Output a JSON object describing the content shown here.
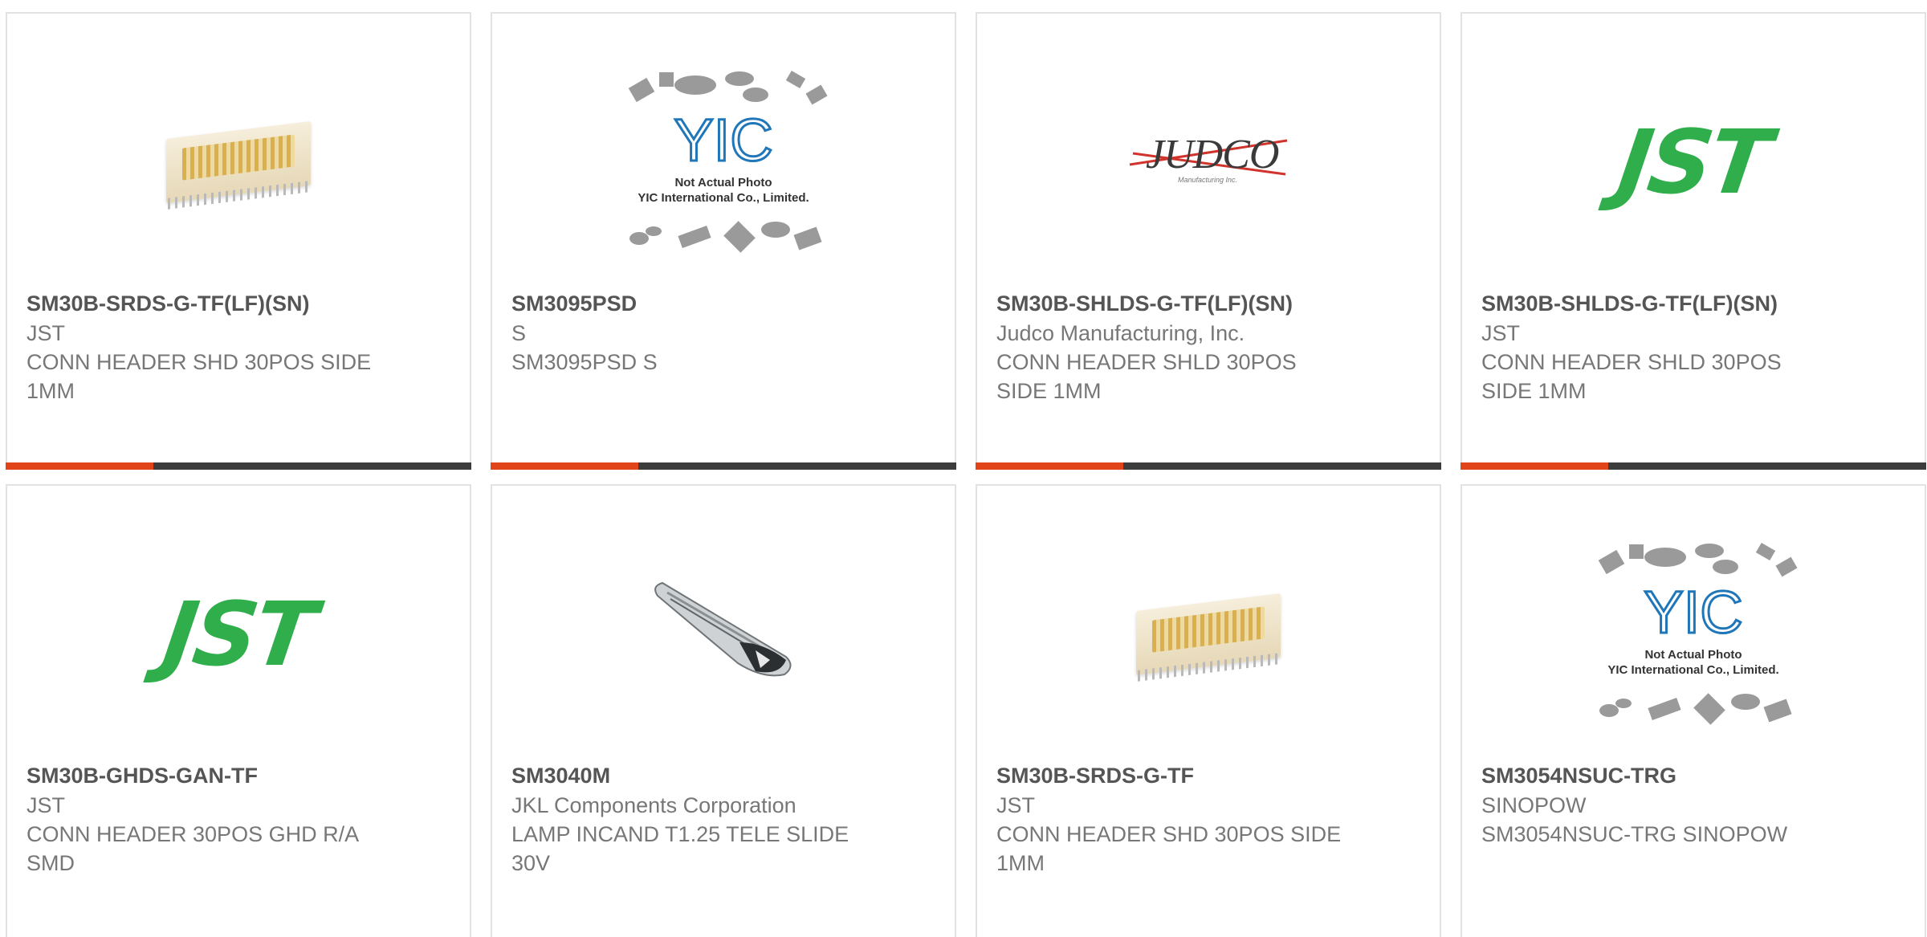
{
  "products": [
    {
      "part_number": "SM30B-SRDS-G-TF(LF)(SN)",
      "manufacturer": "JST",
      "description": "CONN HEADER SHD 30POS SIDE 1MM",
      "image_icon": "connector-header-photo"
    },
    {
      "part_number": "SM3095PSD",
      "manufacturer": "S",
      "description": "SM3095PSD S",
      "image_icon": "yic-placeholder-photo"
    },
    {
      "part_number": "SM30B-SHLDS-G-TF(LF)(SN)",
      "manufacturer": "Judco Manufacturing, Inc.",
      "description": "CONN HEADER SHLD 30POS SIDE 1MM",
      "image_icon": "judco-logo"
    },
    {
      "part_number": "SM30B-SHLDS-G-TF(LF)(SN)",
      "manufacturer": "JST",
      "description": "CONN HEADER SHLD 30POS SIDE 1MM",
      "image_icon": "jst-logo"
    },
    {
      "part_number": "SM30B-GHDS-GAN-TF",
      "manufacturer": "JST",
      "description": "CONN HEADER 30POS GHD R/A SMD",
      "image_icon": "jst-logo"
    },
    {
      "part_number": "SM3040M",
      "manufacturer": "JKL Components Corporation",
      "description": "LAMP INCAND T1.25 TELE SLIDE 30V",
      "image_icon": "lamp-photo"
    },
    {
      "part_number": "SM30B-SRDS-G-TF",
      "manufacturer": "JST",
      "description": "CONN HEADER SHD 30POS SIDE 1MM",
      "image_icon": "connector-header-photo"
    },
    {
      "part_number": "SM3054NSUC-TRG",
      "manufacturer": "SINOPOW",
      "description": "SM3054NSUC-TRG SINOPOW",
      "image_icon": "yic-placeholder-photo"
    }
  ],
  "placeholder": {
    "logo_text": "YIC",
    "line1": "Not Actual Photo",
    "line2": "YIC International Co., Limited."
  },
  "judco_logo": {
    "word": "JUDCO",
    "sub": "Manufacturing Inc."
  },
  "jst_logo": "JST",
  "colors": {
    "accent": "#e04418",
    "bar": "#3c3c3c",
    "jst_green": "#2fae4b",
    "yic_blue": "#1f76b8"
  }
}
